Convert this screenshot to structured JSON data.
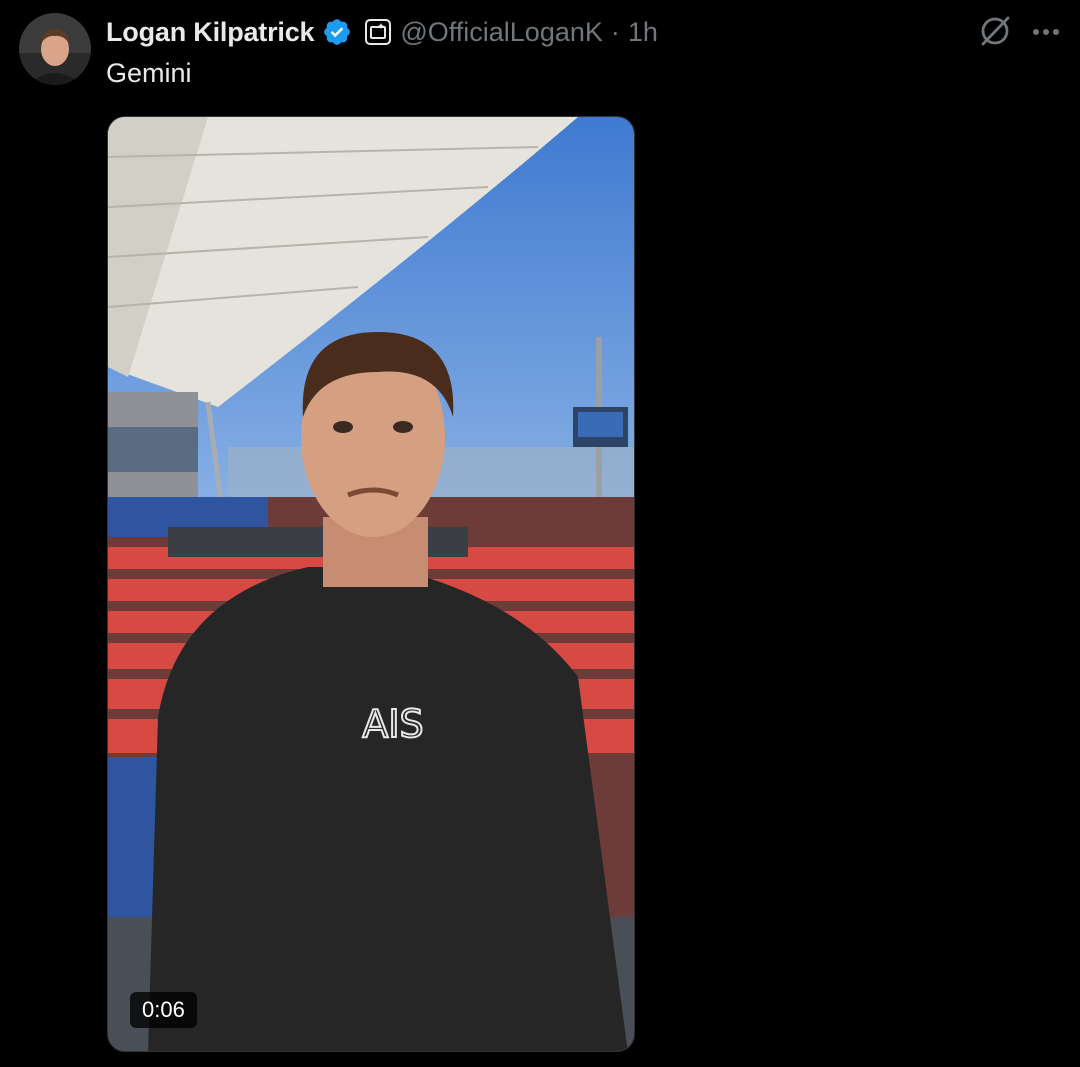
{
  "tweet": {
    "author_name": "Logan Kilpatrick",
    "handle": "@OfficialLoganK",
    "separator": "·",
    "time": "1h",
    "text": "Gemini"
  },
  "video": {
    "duration": "0:06",
    "shirt_logo_text": "AIS"
  },
  "colors": {
    "background": "#000000",
    "primary_text": "#e7e9ea",
    "secondary_text": "#71767b",
    "verified_blue": "#1d9bf0"
  },
  "icons": {
    "verified": "verified-badge-icon",
    "affiliation": "affiliation-badge-icon",
    "grok": "grok-icon",
    "more": "more-icon"
  }
}
